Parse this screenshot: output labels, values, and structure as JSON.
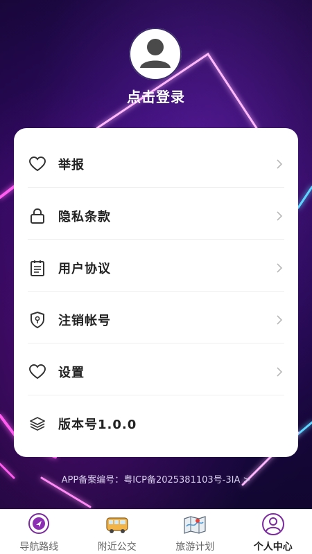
{
  "header": {
    "login_label": "点击登录"
  },
  "menu": [
    {
      "label": "举报",
      "icon": "heart-icon"
    },
    {
      "label": "隐私条款",
      "icon": "lock-icon"
    },
    {
      "label": "用户协议",
      "icon": "clipboard-icon"
    },
    {
      "label": "注销帐号",
      "icon": "shield-icon"
    },
    {
      "label": "设置",
      "icon": "heart-icon"
    },
    {
      "label": "版本号1.0.0",
      "icon": "layers-icon"
    }
  ],
  "footer": {
    "icp_text": "APP备案编号：粤ICP备2025381103号-3ⅠA >"
  },
  "tabbar": {
    "tabs": [
      {
        "label": "导航路线",
        "icon": "navigation-icon"
      },
      {
        "label": "附近公交",
        "icon": "bus-icon"
      },
      {
        "label": "旅游计划",
        "icon": "map-icon"
      },
      {
        "label": "个人中心",
        "icon": "user-icon",
        "active": true
      }
    ]
  },
  "colors": {
    "accent": "#7b2a9e",
    "background_top": "#240a55",
    "neon_pink": "#ff5cf0",
    "neon_cyan": "#5fd6ff"
  }
}
